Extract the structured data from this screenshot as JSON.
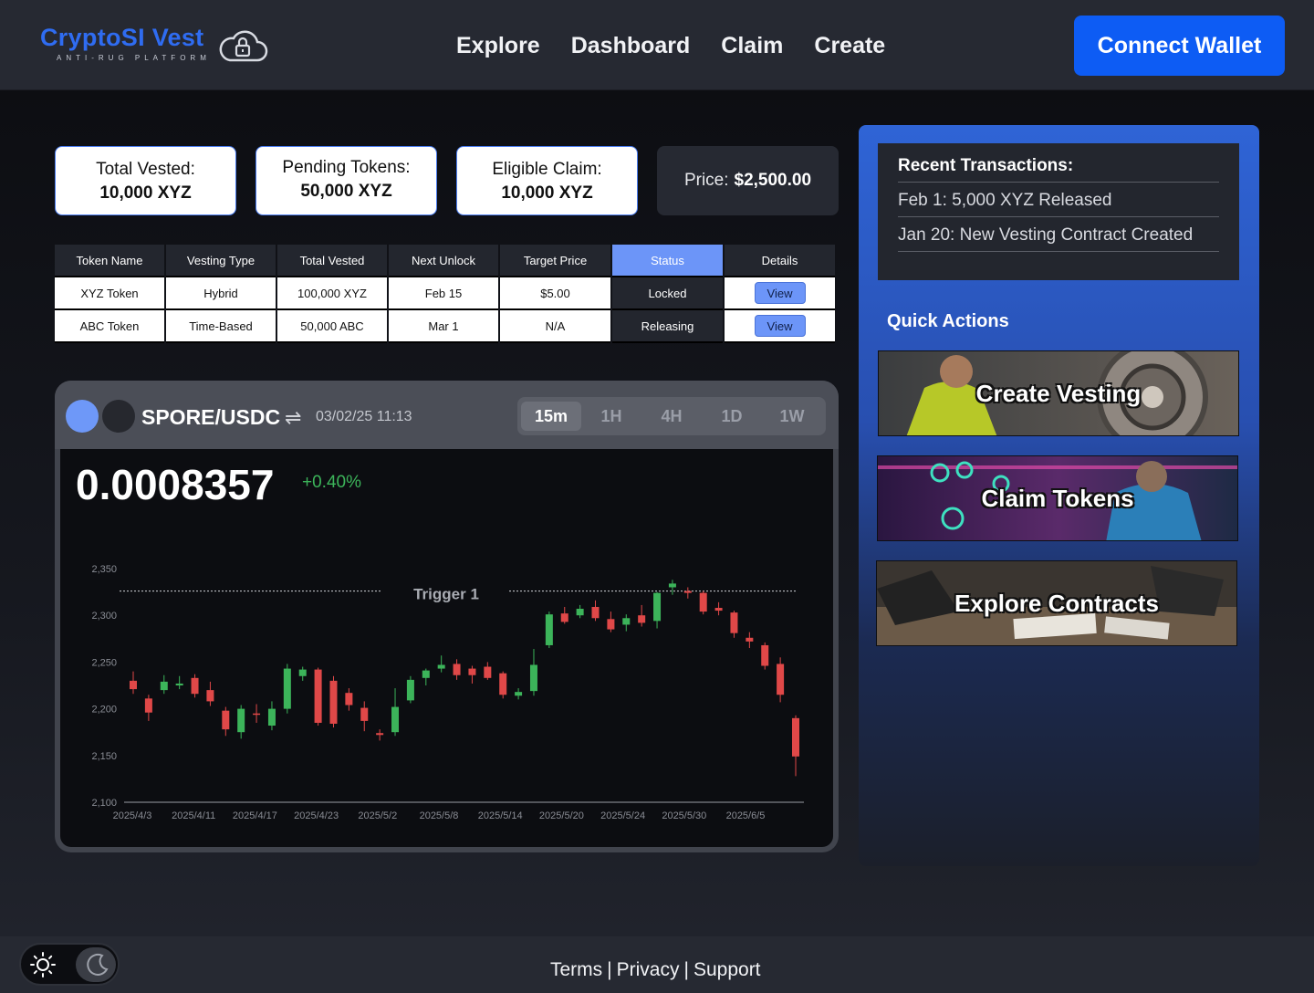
{
  "brand": {
    "title": "CryptoSI Vest",
    "tagline": "ANTI-RUG PLATFORM"
  },
  "nav": [
    "Explore",
    "Dashboard",
    "Claim",
    "Create"
  ],
  "connect_label": "Connect Wallet",
  "stats": [
    {
      "label": "Total Vested:",
      "value": "10,000 XYZ"
    },
    {
      "label": "Pending Tokens:",
      "value": "50,000 XYZ"
    },
    {
      "label": "Eligible Claim:",
      "value": "10,000 XYZ"
    }
  ],
  "price": {
    "label": "Price:",
    "value": "$2,500.00"
  },
  "table": {
    "headers": [
      "Token Name",
      "Vesting Type",
      "Total Vested",
      "Next Unlock",
      "Target Price",
      "Status",
      "Details"
    ],
    "rows": [
      {
        "token": "XYZ Token",
        "type": "Hybrid",
        "total": "100,000 XYZ",
        "unlock": "Feb 15",
        "target": "$5.00",
        "status": "Locked",
        "details": "View"
      },
      {
        "token": "ABC Token",
        "type": "Time-Based",
        "total": "50,000 ABC",
        "unlock": "Mar 1",
        "target": "N/A",
        "status": "Releasing",
        "details": "View"
      }
    ]
  },
  "chart_panel": {
    "pair": "SPORE/USDC",
    "datetime": "03/02/25 11:13",
    "timeframes": [
      "15m",
      "1H",
      "4H",
      "1D",
      "1W"
    ],
    "active_timeframe": "15m",
    "last_price": "0.0008357",
    "change": "+0.40%"
  },
  "chart_data": {
    "type": "candlestick",
    "ylim": [
      2100,
      2350
    ],
    "yticks": [
      "2,100",
      "2,150",
      "2,200",
      "2,250",
      "2,300",
      "2,350"
    ],
    "xticks": [
      "2025/4/3",
      "2025/4/11",
      "2025/4/17",
      "2025/4/23",
      "2025/5/2",
      "2025/5/8",
      "2025/5/14",
      "2025/5/20",
      "2025/5/24",
      "2025/5/30",
      "2025/6/5"
    ],
    "trigger": {
      "label": "Trigger 1",
      "value": 2326
    },
    "candles": [
      [
        2230,
        2221,
        2240,
        2216
      ],
      [
        2211,
        2196,
        2215,
        2187
      ],
      [
        2220,
        2229,
        2236,
        2216
      ],
      [
        2225,
        2227,
        2235,
        2221
      ],
      [
        2233,
        2216,
        2237,
        2212
      ],
      [
        2220,
        2208,
        2229,
        2203
      ],
      [
        2198,
        2178,
        2202,
        2171
      ],
      [
        2175,
        2200,
        2204,
        2168
      ],
      [
        2195,
        2194,
        2205,
        2185
      ],
      [
        2182,
        2200,
        2208,
        2177
      ],
      [
        2200,
        2243,
        2248,
        2195
      ],
      [
        2235,
        2242,
        2245,
        2230
      ],
      [
        2242,
        2185,
        2244,
        2182
      ],
      [
        2230,
        2184,
        2235,
        2180
      ],
      [
        2217,
        2204,
        2222,
        2198
      ],
      [
        2201,
        2187,
        2208,
        2176
      ],
      [
        2174,
        2172,
        2178,
        2166
      ],
      [
        2175,
        2202,
        2222,
        2171
      ],
      [
        2209,
        2231,
        2235,
        2206
      ],
      [
        2233,
        2241,
        2243,
        2225
      ],
      [
        2243,
        2247,
        2257,
        2239
      ],
      [
        2248,
        2236,
        2253,
        2231
      ],
      [
        2243,
        2236,
        2246,
        2227
      ],
      [
        2245,
        2233,
        2250,
        2231
      ],
      [
        2238,
        2215,
        2240,
        2211
      ],
      [
        2214,
        2218,
        2222,
        2210
      ],
      [
        2219,
        2247,
        2264,
        2214
      ],
      [
        2268,
        2301,
        2304,
        2265
      ],
      [
        2302,
        2293,
        2309,
        2291
      ],
      [
        2300,
        2307,
        2311,
        2297
      ],
      [
        2309,
        2297,
        2316,
        2294
      ],
      [
        2296,
        2285,
        2304,
        2282
      ],
      [
        2290,
        2297,
        2301,
        2283
      ],
      [
        2300,
        2292,
        2311,
        2288
      ],
      [
        2294,
        2324,
        2325,
        2286
      ],
      [
        2330,
        2334,
        2338,
        2322
      ],
      [
        2326,
        2324,
        2330,
        2318
      ],
      [
        2324,
        2304,
        2326,
        2301
      ],
      [
        2308,
        2305,
        2314,
        2300
      ],
      [
        2303,
        2281,
        2305,
        2276
      ],
      [
        2276,
        2272,
        2282,
        2265
      ],
      [
        2268,
        2246,
        2271,
        2242
      ],
      [
        2248,
        2215,
        2255,
        2207
      ],
      [
        2190,
        2149,
        2193,
        2128
      ]
    ]
  },
  "recent": {
    "title": "Recent Transactions:",
    "items": [
      "Feb 1: 5,000 XYZ Released",
      "Jan 20: New Vesting Contract Created"
    ]
  },
  "quick_actions": {
    "title": "Quick Actions",
    "items": [
      "Create Vesting",
      "Claim Tokens",
      "Explore Contracts"
    ]
  },
  "footer": {
    "links": [
      "Terms",
      "Privacy",
      "Support"
    ]
  },
  "colors": {
    "accent": "#0d5cf4",
    "up": "#3cb45a",
    "down": "#e04848",
    "highlight": "#6c95f8"
  }
}
